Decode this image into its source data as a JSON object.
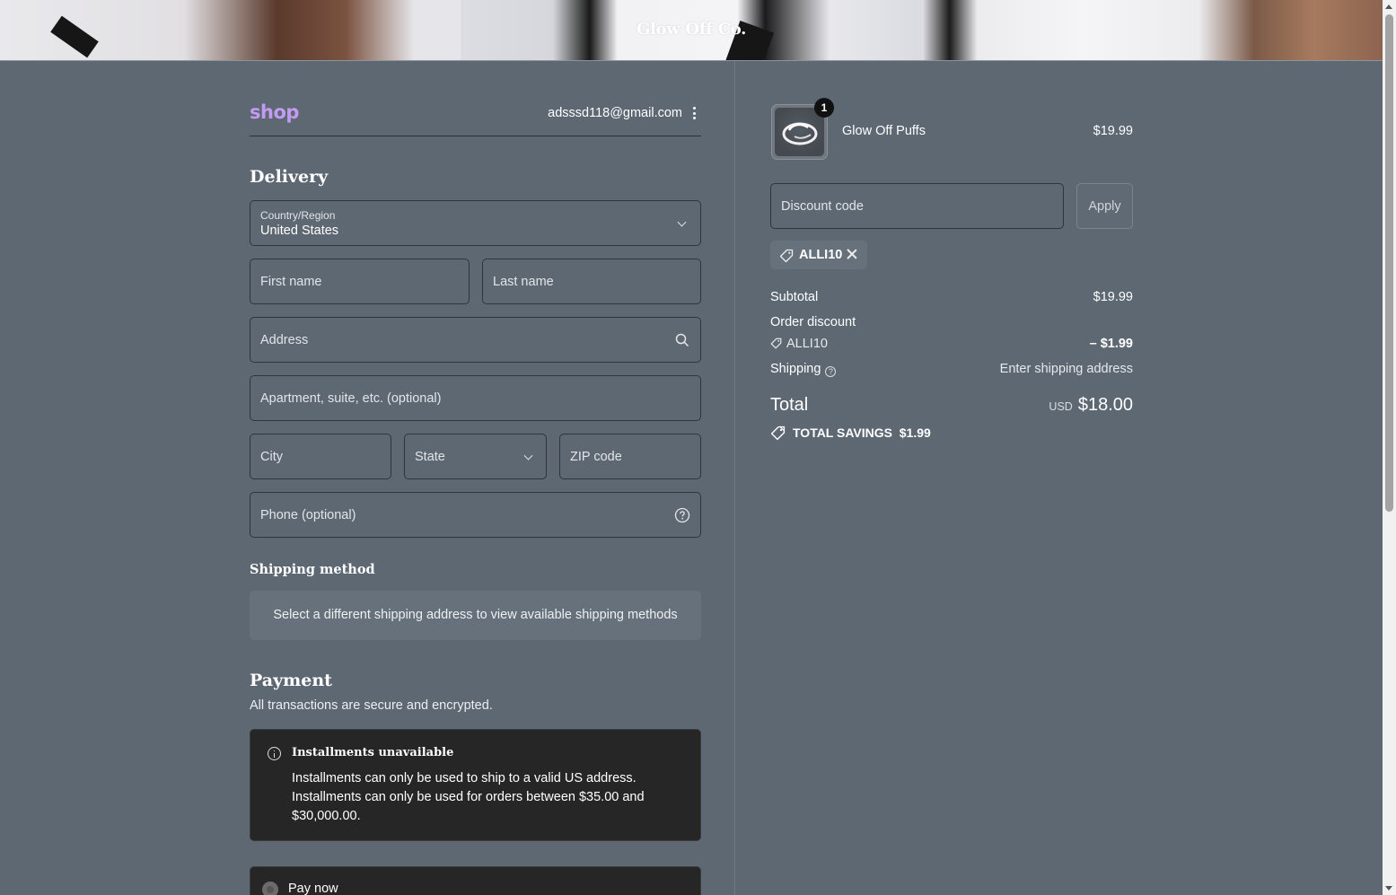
{
  "banner": {
    "store_name": "Glow Off Co."
  },
  "header": {
    "logo": "shop",
    "email": "adsssd118@gmail.com"
  },
  "delivery": {
    "title": "Delivery",
    "country_label": "Country/Region",
    "country_value": "United States",
    "first_name_placeholder": "First name",
    "last_name_placeholder": "Last name",
    "address_placeholder": "Address",
    "apartment_placeholder": "Apartment, suite, etc. (optional)",
    "city_placeholder": "City",
    "state_placeholder": "State",
    "zip_placeholder": "ZIP code",
    "phone_placeholder": "Phone (optional)"
  },
  "shipping_method": {
    "title": "Shipping method",
    "notice": "Select a different shipping address to view available shipping methods"
  },
  "payment": {
    "title": "Payment",
    "subtitle": "All transactions are secure and encrypted.",
    "installments_title": "Installments unavailable",
    "installments_lines": [
      "Installments can only be used to ship to a valid US address.",
      "Installments can only be used for orders between $35.00 and",
      "$30,000.00."
    ],
    "pay_now_label": "Pay now"
  },
  "order": {
    "product": {
      "name": "Glow Off Puffs",
      "price": "$19.99",
      "quantity": "1"
    },
    "discount_placeholder": "Discount code",
    "apply_label": "Apply",
    "applied_code": "ALLI10",
    "subtotal_label": "Subtotal",
    "subtotal_value": "$19.99",
    "order_discount_label": "Order discount",
    "discount_code": "ALLI10",
    "discount_value": "– $1.99",
    "shipping_label": "Shipping",
    "shipping_value": "Enter shipping address",
    "total_label": "Total",
    "currency": "USD",
    "total_value": "$18.00",
    "savings_label": "TOTAL SAVINGS",
    "savings_value": "$1.99"
  },
  "icons": {
    "menu": "vertical-dots-icon",
    "search": "search-icon",
    "help": "question-circle-icon",
    "info": "info-circle-icon",
    "tag": "tag-icon",
    "close": "close-icon",
    "chevron": "chevron-down-icon"
  },
  "colors": {
    "background": "#5d6873",
    "shop_logo": "#c39cf2",
    "dark_panel": "#262626",
    "field_border": "#2e353d"
  }
}
